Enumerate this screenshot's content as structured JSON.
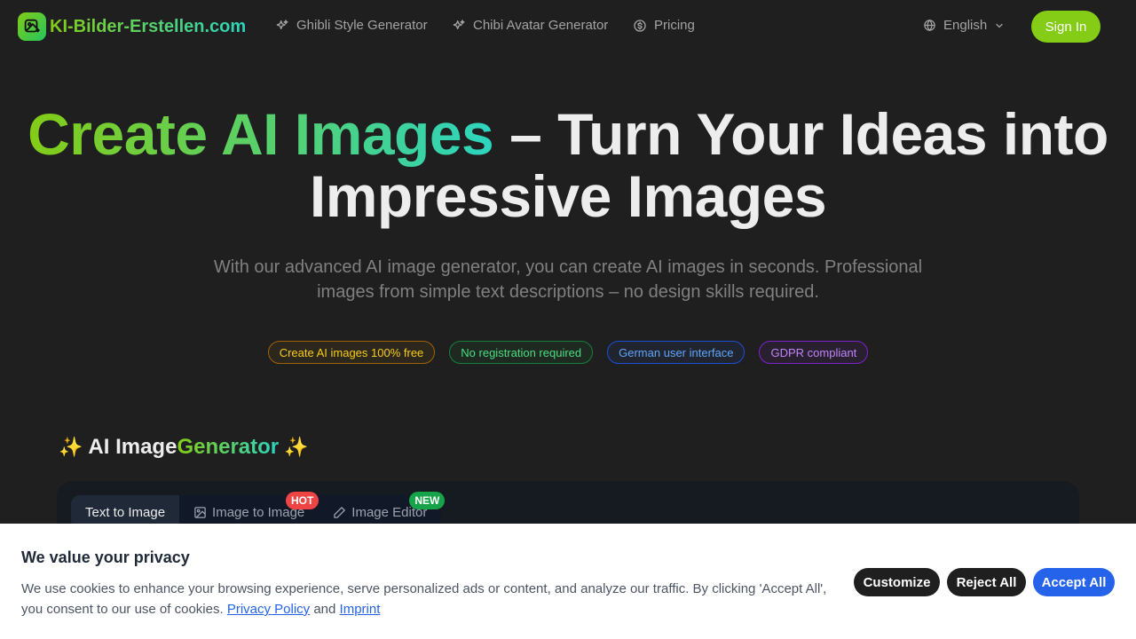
{
  "brand": {
    "name": "KI-Bilder-Erstellen.com",
    "accent": "#84cc16",
    "accent2": "#2dd4bf"
  },
  "nav": {
    "items": [
      {
        "label": "Ghibli Style Generator",
        "icon": "sparkles-icon"
      },
      {
        "label": "Chibi Avatar Generator",
        "icon": "sparkles-icon"
      },
      {
        "label": "Pricing",
        "icon": "dollar-circle-icon"
      }
    ],
    "language": "English",
    "sign_in": "Sign In"
  },
  "hero": {
    "title_highlight": "Create AI Images",
    "title_rest": " – Turn Your Ideas into Impressive Images",
    "subtitle": "With our advanced AI image generator, you can create AI images in seconds. Professional images from simple text descriptions – no design skills required.",
    "badges": [
      "Create AI images 100% free",
      "No registration required",
      "German user interface",
      "GDPR compliant"
    ]
  },
  "generator": {
    "title_white": "AI Image",
    "title_grad": "Generator",
    "spark": "✨",
    "tabs": [
      {
        "label": "Text to Image"
      },
      {
        "label": "Image to Image",
        "tag": "HOT"
      },
      {
        "label": "Image Editor",
        "tag": "NEW"
      }
    ]
  },
  "cookie": {
    "title": "We value your privacy",
    "text": "We use cookies to enhance your browsing experience, serve personalized ads or content, and analyze our traffic. By clicking 'Accept All', you consent to our use of cookies.",
    "privacy_link": "Privacy Policy",
    "and": "and",
    "imprint_link": "Imprint",
    "customize": "Customize",
    "reject": "Reject All",
    "accept": "Accept All"
  }
}
